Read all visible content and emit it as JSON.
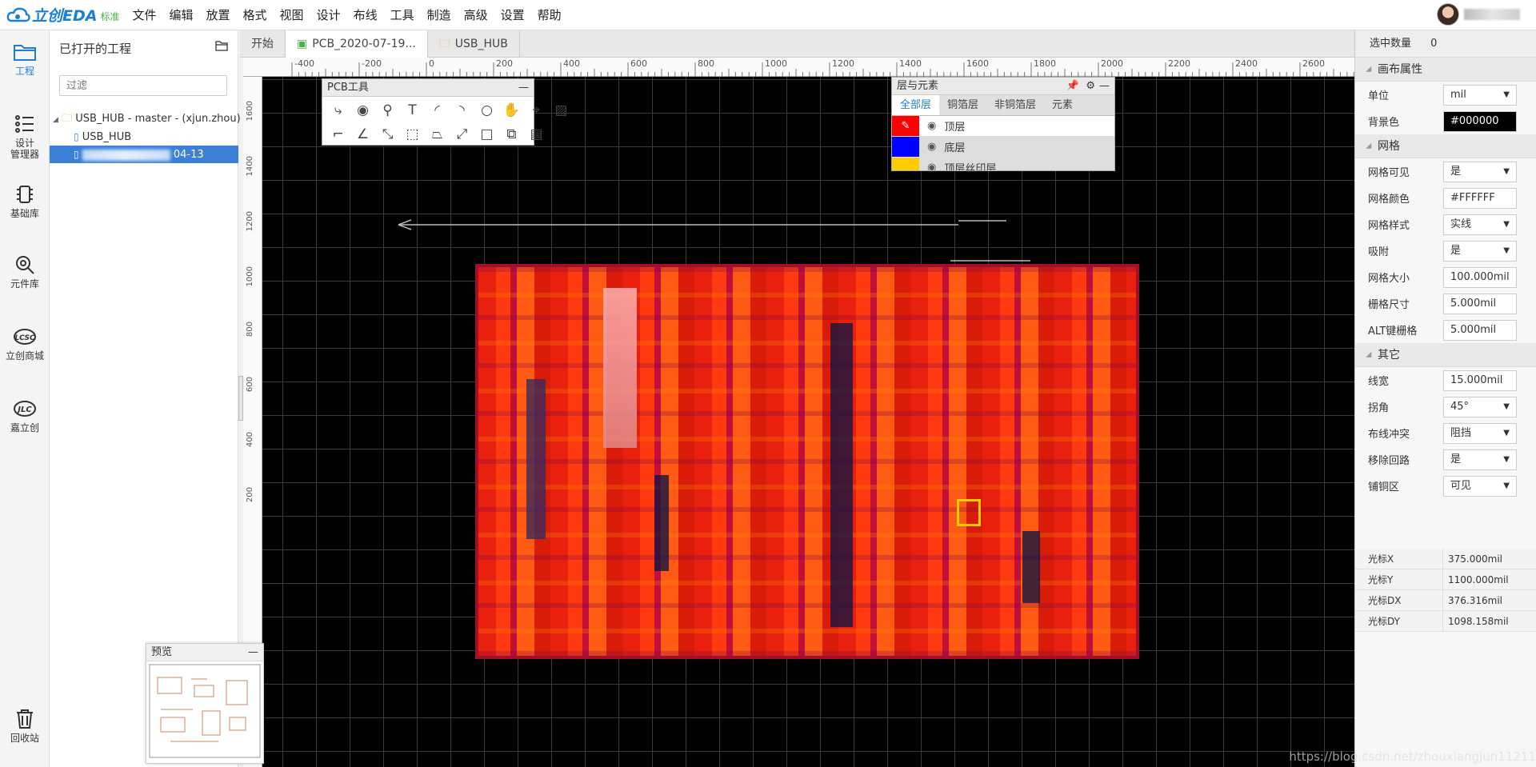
{
  "app": {
    "logo_text": "立创EDA",
    "logo_edition": "标准"
  },
  "menu": [
    "文件",
    "编辑",
    "放置",
    "格式",
    "视图",
    "设计",
    "布线",
    "工具",
    "制造",
    "高级",
    "设置",
    "帮助"
  ],
  "nav": [
    {
      "label": "工程",
      "icon": "folder-icon"
    },
    {
      "label": "设计\n管理器",
      "icon": "design-manager-icon"
    },
    {
      "label": "基础库",
      "icon": "chip-icon"
    },
    {
      "label": "元件库",
      "icon": "search-icon"
    },
    {
      "label": "立创商城",
      "icon": "lcsc-icon"
    },
    {
      "label": "嘉立创",
      "icon": "jlc-icon"
    },
    {
      "label": "回收站",
      "icon": "trash-icon"
    }
  ],
  "project": {
    "title": "已打开的工程",
    "filter_placeholder": "过滤",
    "tree": [
      "USB_HUB - master - (xjun.zhou)",
      "USB_HUB",
      "04-13"
    ]
  },
  "preview": {
    "title": "预览",
    "min": "—"
  },
  "tabs": [
    "开始",
    "PCB_2020-07-19...",
    "USB_HUB"
  ],
  "ruler_x": [
    "-400",
    "-200",
    "0",
    "200",
    "400",
    "600",
    "800",
    "1000",
    "1200",
    "1400",
    "1600",
    "1800",
    "2000",
    "2200",
    "2400",
    "2600"
  ],
  "ruler_y": [
    "1600",
    "1400",
    "1200",
    "1000",
    "800",
    "600",
    "400",
    "200"
  ],
  "pcb_tools": {
    "title": "PCB工具",
    "min": "—"
  },
  "layers": {
    "title": "层与元素",
    "tabs": [
      "全部层",
      "铜箔层",
      "非铜箔层",
      "元素"
    ],
    "rows": [
      {
        "name": "顶层",
        "color": "#ff0000"
      },
      {
        "name": "底层",
        "color": "#0000ff"
      },
      {
        "name": "顶层丝印层",
        "color": "#ffcc00"
      }
    ]
  },
  "right_panel": {
    "selected_label": "选中数量",
    "selected_value": "0",
    "canvas_title": "画布属性",
    "unit": {
      "label": "单位",
      "value": "mil"
    },
    "bg": {
      "label": "背景色",
      "value": "#000000"
    },
    "grid_title": "网格",
    "grid_visible": {
      "label": "网格可见",
      "value": "是"
    },
    "grid_color": {
      "label": "网格颜色",
      "value": "#FFFFFF"
    },
    "grid_style": {
      "label": "网格样式",
      "value": "实线"
    },
    "snap": {
      "label": "吸附",
      "value": "是"
    },
    "grid_size": {
      "label": "网格大小",
      "value": "100.000mil"
    },
    "snap_size": {
      "label": "栅格尺寸",
      "value": "5.000mil"
    },
    "alt_snap": {
      "label": "ALT键栅格",
      "value": "5.000mil"
    },
    "other_title": "其它",
    "line_width": {
      "label": "线宽",
      "value": "15.000mil"
    },
    "corner": {
      "label": "拐角",
      "value": "45°"
    },
    "conflict": {
      "label": "布线冲突",
      "value": "阻挡"
    },
    "remove_loop": {
      "label": "移除回路",
      "value": "是"
    },
    "copper": {
      "label": "铺铜区",
      "value": "可见"
    },
    "cursor": [
      {
        "label": "光标X",
        "value": "375.000mil"
      },
      {
        "label": "光标Y",
        "value": "1100.000mil"
      },
      {
        "label": "光标DX",
        "value": "376.316mil"
      },
      {
        "label": "光标DY",
        "value": "1098.158mil"
      }
    ]
  },
  "watermark": "https://blog.csdn.net/zhouxiangjun11211"
}
